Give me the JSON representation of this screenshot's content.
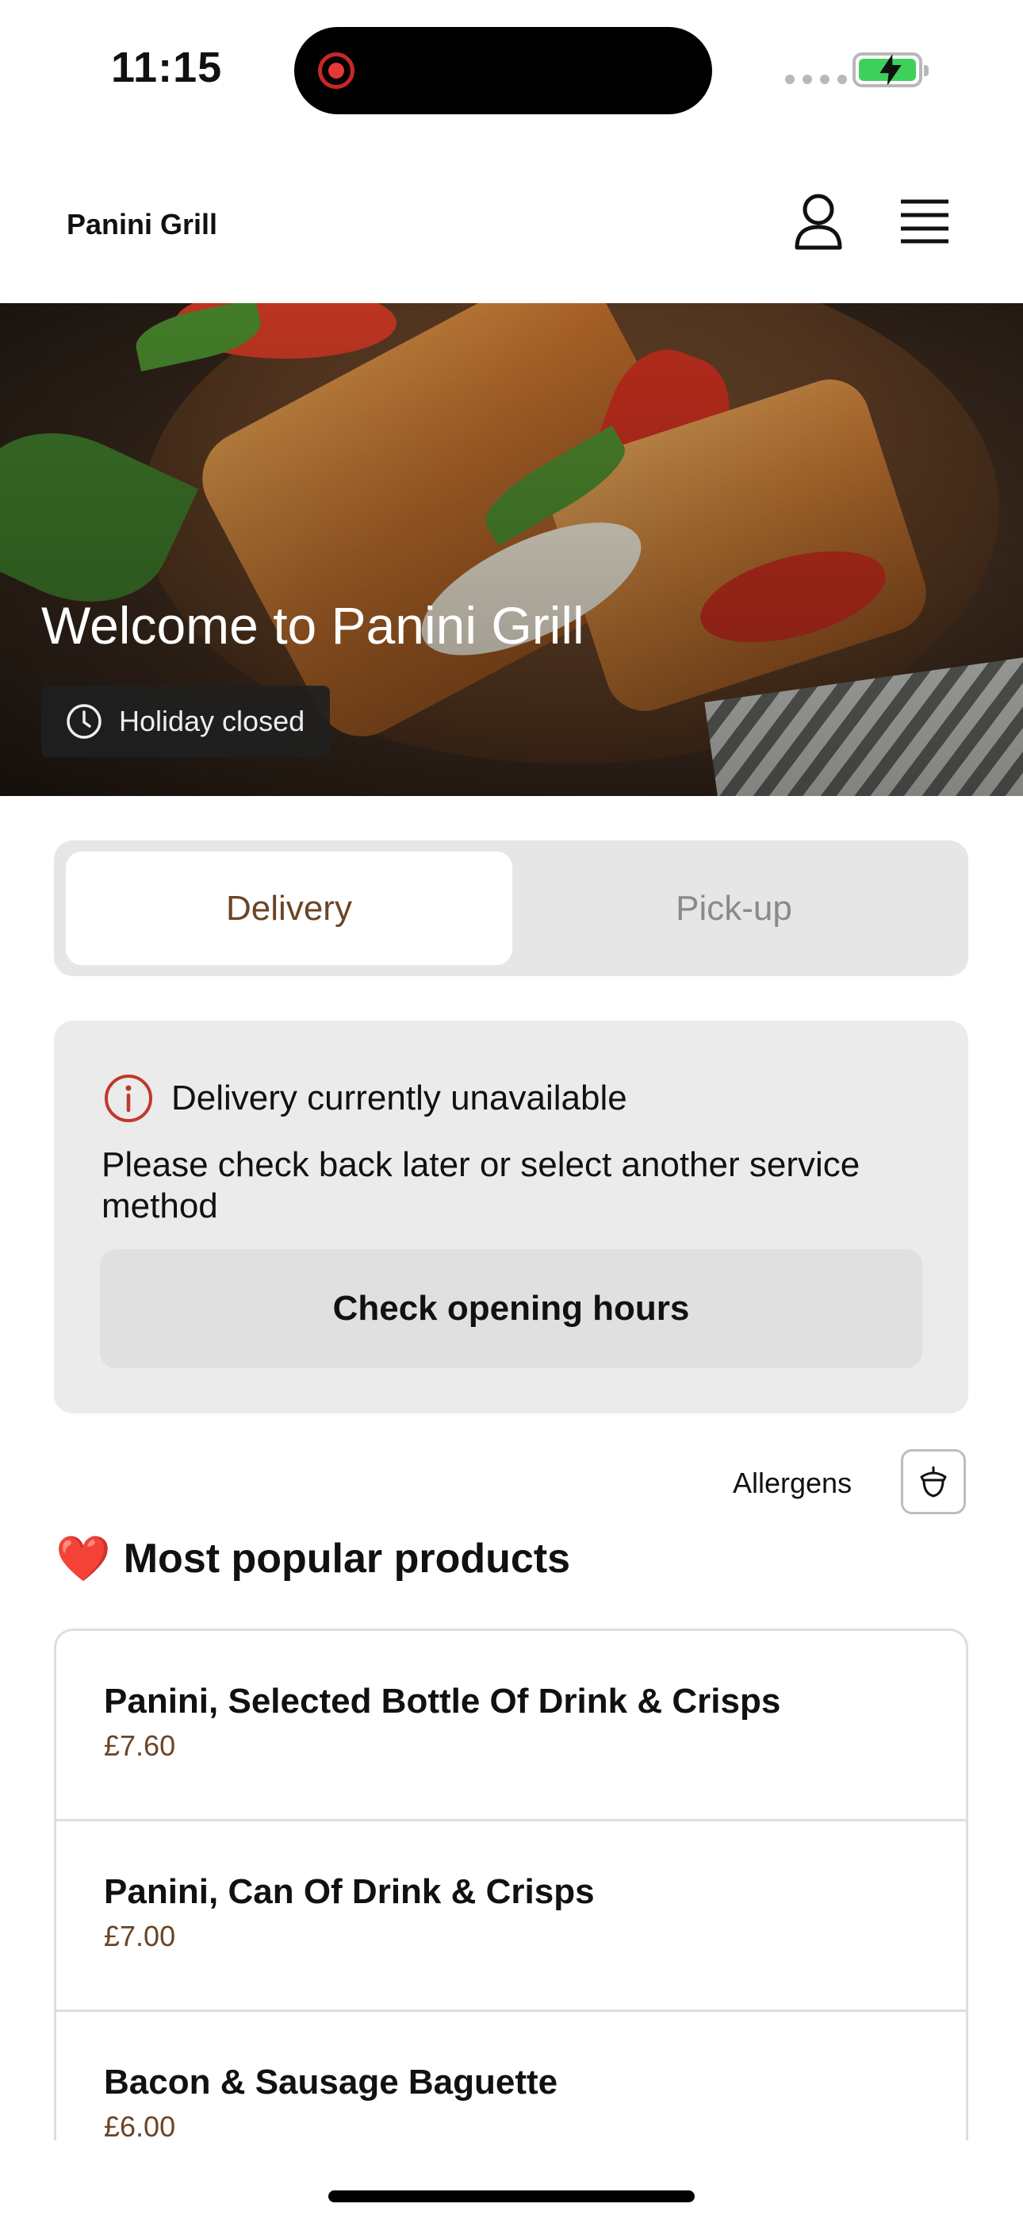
{
  "status_bar": {
    "time": "11:15"
  },
  "header": {
    "brand": "Panini Grill",
    "icons": [
      "user-icon",
      "menu-icon"
    ]
  },
  "hero": {
    "title": "Welcome to Panini Grill",
    "status_badge": "Holiday closed"
  },
  "service_toggle": {
    "delivery_label": "Delivery",
    "pickup_label": "Pick-up",
    "selected": "Delivery"
  },
  "notice": {
    "title": "Delivery currently unavailable",
    "body": "Please check back later or select another service method",
    "button_label": "Check opening hours"
  },
  "allergens": {
    "label": "Allergens"
  },
  "popular": {
    "emoji": "❤️",
    "title": "Most popular products",
    "products": [
      {
        "name": "Panini, Selected Bottle Of Drink & Crisps",
        "price": "£7.60"
      },
      {
        "name": "Panini, Can Of Drink & Crisps",
        "price": "£7.00"
      },
      {
        "name": "Bacon & Sausage Baguette",
        "price": "£6.00"
      }
    ]
  },
  "colors": {
    "accent_brown": "#6b4526",
    "alert_red": "#c0392b",
    "battery_green": "#3dd15c"
  }
}
